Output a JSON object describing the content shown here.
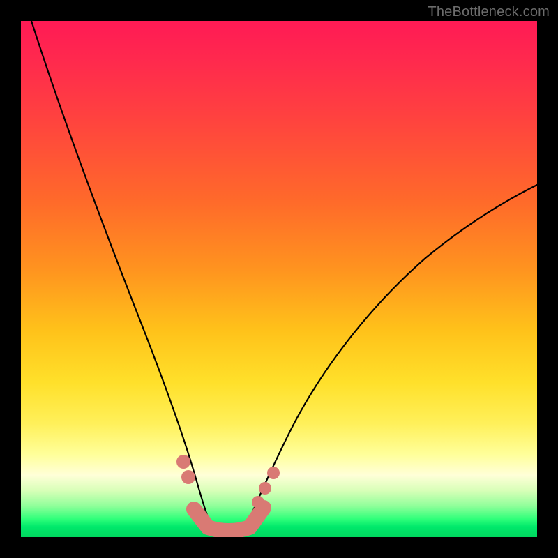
{
  "watermark": "TheBottleneck.com",
  "colors": {
    "frame": "#000000",
    "curve": "#000000",
    "marker": "#d97a74",
    "gradient_stops": [
      "#ff1a55",
      "#ff4040",
      "#ff931f",
      "#ffe02a",
      "#ffff9a",
      "#2fff7a",
      "#00d85f"
    ]
  },
  "chart_data": {
    "type": "line",
    "title": "",
    "xlabel": "",
    "ylabel": "",
    "xlim": [
      0,
      100
    ],
    "ylim": [
      0,
      100
    ],
    "note": "Axes are unlabeled in the source image; x and y are normalized 0–100 estimates read from pixel position.",
    "series": [
      {
        "name": "left-curve",
        "x": [
          2,
          6,
          10,
          14,
          18,
          22,
          26,
          29,
          31,
          33,
          34.5,
          36
        ],
        "y": [
          100,
          84,
          69,
          55,
          43,
          32,
          22,
          14,
          9,
          5,
          2.5,
          1
        ]
      },
      {
        "name": "right-curve",
        "x": [
          42,
          44,
          47,
          51,
          56,
          62,
          69,
          77,
          86,
          96,
          100
        ],
        "y": [
          1,
          2.5,
          6,
          12,
          20,
          29,
          38,
          47,
          55,
          63,
          66
        ]
      },
      {
        "name": "trough-band",
        "x": [
          33,
          36,
          39,
          42,
          44
        ],
        "y": [
          3,
          1,
          0.8,
          1,
          3
        ]
      }
    ],
    "markers": [
      {
        "series": "left-curve",
        "x": 30.5,
        "y": 11
      },
      {
        "series": "left-curve",
        "x": 31.5,
        "y": 8
      },
      {
        "series": "right-curve",
        "x": 44.5,
        "y": 4
      },
      {
        "series": "right-curve",
        "x": 46.0,
        "y": 7
      },
      {
        "series": "right-curve",
        "x": 47.5,
        "y": 10
      }
    ]
  }
}
